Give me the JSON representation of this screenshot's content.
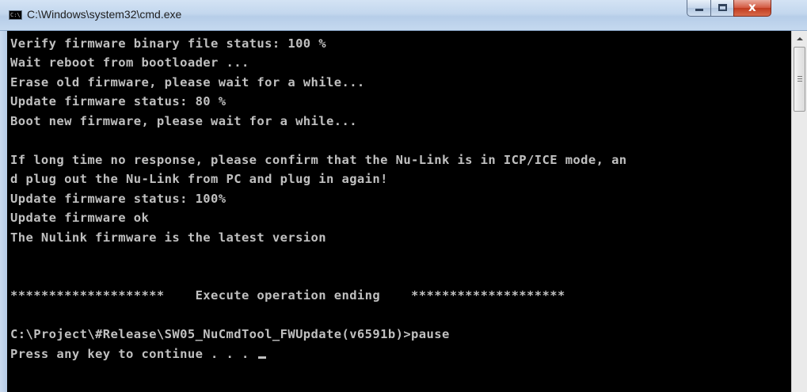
{
  "window": {
    "title": "C:\\Windows\\system32\\cmd.exe",
    "icon": "cmd-icon",
    "icon_text": "C:\\"
  },
  "controls": {
    "minimize_icon": "minimize-icon",
    "maximize_icon": "maximize-icon",
    "close_icon": "close-icon",
    "close_glyph": "x"
  },
  "console": {
    "background": "#000000",
    "foreground": "#c0c0c0",
    "lines": [
      "Verify firmware binary file status: 100 %",
      "Wait reboot from bootloader ...",
      "Erase old firmware, please wait for a while...",
      "Update firmware status: 80 %",
      "Boot new firmware, please wait for a while...",
      "",
      "If long time no response, please confirm that the Nu-Link is in ICP/ICE mode, an",
      "d plug out the Nu-Link from PC and plug in again!",
      "Update firmware status: 100%",
      "Update firmware ok",
      "The Nulink firmware is the latest version",
      "",
      "",
      "********************    Execute operation ending    ********************",
      "",
      "C:\\Project\\#Release\\SW05_NuCmdTool_FWUpdate(v6591b)>pause",
      "Press any key to continue . . . "
    ]
  },
  "scrollbar": {
    "up_icon": "scroll-up-arrow-icon"
  }
}
